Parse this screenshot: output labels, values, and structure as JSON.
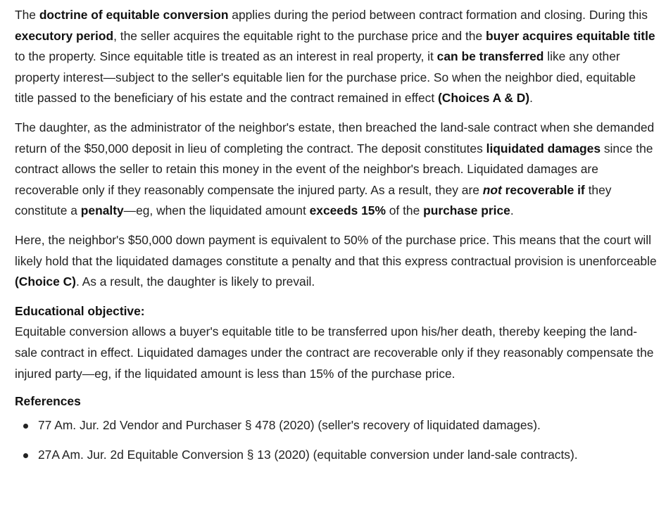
{
  "para1": {
    "t1": "The ",
    "b1": "doctrine of equitable conversion",
    "t2": " applies during the period between contract formation and closing. During this ",
    "b2": "executory period",
    "t3": ", the seller acquires the equitable right to the purchase price and the ",
    "b3": "buyer acquires equitable title",
    "t4": " to the property.  Since equitable title is treated as an interest in real property, it ",
    "b4": "can be transferred",
    "t5": " like any other property interest—subject to the seller's equitable lien for the purchase price.  So when the neighbor died, equitable title passed to the beneficiary of his estate and the contract remained in effect ",
    "b5": "(Choices A & D)",
    "t6": "."
  },
  "para2": {
    "t1": "The daughter, as the administrator of the neighbor's estate, then breached the land-sale contract when she demanded return of the $50,000 deposit in lieu of completing the contract.  The deposit constitutes ",
    "b1": "liquidated damages",
    "t2": " since the contract allows the seller to retain this money in the event of the neighbor's breach.  Liquidated damages are recoverable only if they reasonably compensate the injured party.  As a result, they are ",
    "bi1": "not",
    "b2": " recoverable if",
    "t3": " they constitute a ",
    "b3": "penalty",
    "t4": "—eg, when the liquidated amount ",
    "b4": "exceeds 15%",
    "t5": " of the ",
    "b5": "purchase price",
    "t6": "."
  },
  "para3": {
    "t1": "Here, the neighbor's $50,000 down payment is equivalent to 50% of the purchase price.  This means that the court will likely hold that the liquidated damages constitute a penalty and that this express contractual provision is unenforceable ",
    "b1": "(Choice C)",
    "t2": ".  As a result, the daughter is likely to prevail."
  },
  "objective": {
    "heading": "Educational objective:",
    "text": "Equitable conversion allows a buyer's equitable title to be transferred upon his/her death, thereby keeping the land-sale contract in effect.  Liquidated damages under the contract are recoverable only if they reasonably compensate the injured party—eg, if the liquidated amount is less than 15% of the purchase price."
  },
  "references": {
    "heading": "References",
    "items": [
      "77 Am. Jur. 2d Vendor and Purchaser § 478 (2020) (seller's recovery of liquidated damages).",
      "27A Am. Jur. 2d Equitable Conversion § 13 (2020) (equitable conversion under land-sale contracts)."
    ]
  }
}
